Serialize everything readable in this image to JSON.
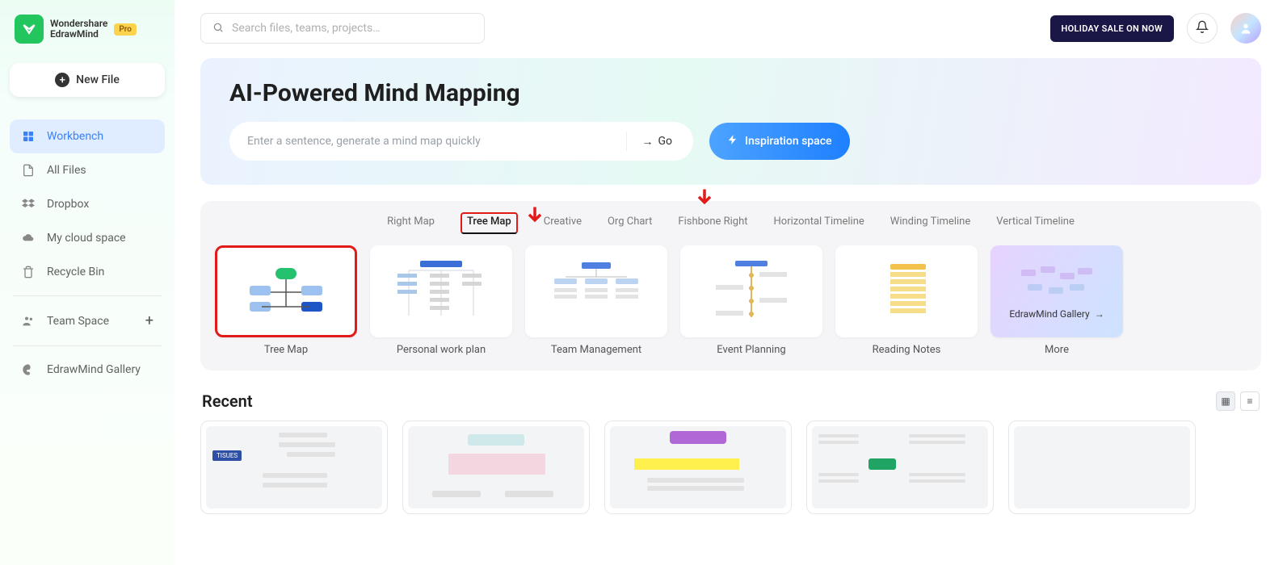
{
  "brand": {
    "name1": "Wondershare",
    "name2": "EdrawMind",
    "badge": "Pro"
  },
  "sidebar": {
    "newFile": "New File",
    "items": [
      {
        "label": "Workbench"
      },
      {
        "label": "All Files"
      },
      {
        "label": "Dropbox"
      },
      {
        "label": "My cloud space"
      },
      {
        "label": "Recycle Bin"
      }
    ],
    "team": "Team Space",
    "gallery": "EdrawMind Gallery"
  },
  "search": {
    "placeholder": "Search files, teams, projects…"
  },
  "topbar": {
    "sale": "HOLIDAY SALE ON NOW"
  },
  "hero": {
    "title": "AI-Powered Mind Mapping",
    "placeholder": "Enter a sentence, generate a mind map quickly",
    "go": "Go",
    "inspiration": "Inspiration space"
  },
  "tabs": [
    "Right Map",
    "Tree Map",
    "Creative",
    "Org Chart",
    "Fishbone Right",
    "Horizontal Timeline",
    "Winding Timeline",
    "Vertical Timeline"
  ],
  "cards": [
    "Tree Map",
    "Personal work plan",
    "Team Management",
    "Event Planning",
    "Reading Notes",
    "More"
  ],
  "galleryCard": "EdrawMind Gallery",
  "recent": {
    "title": "Recent",
    "thumbTag": "TISUES"
  }
}
